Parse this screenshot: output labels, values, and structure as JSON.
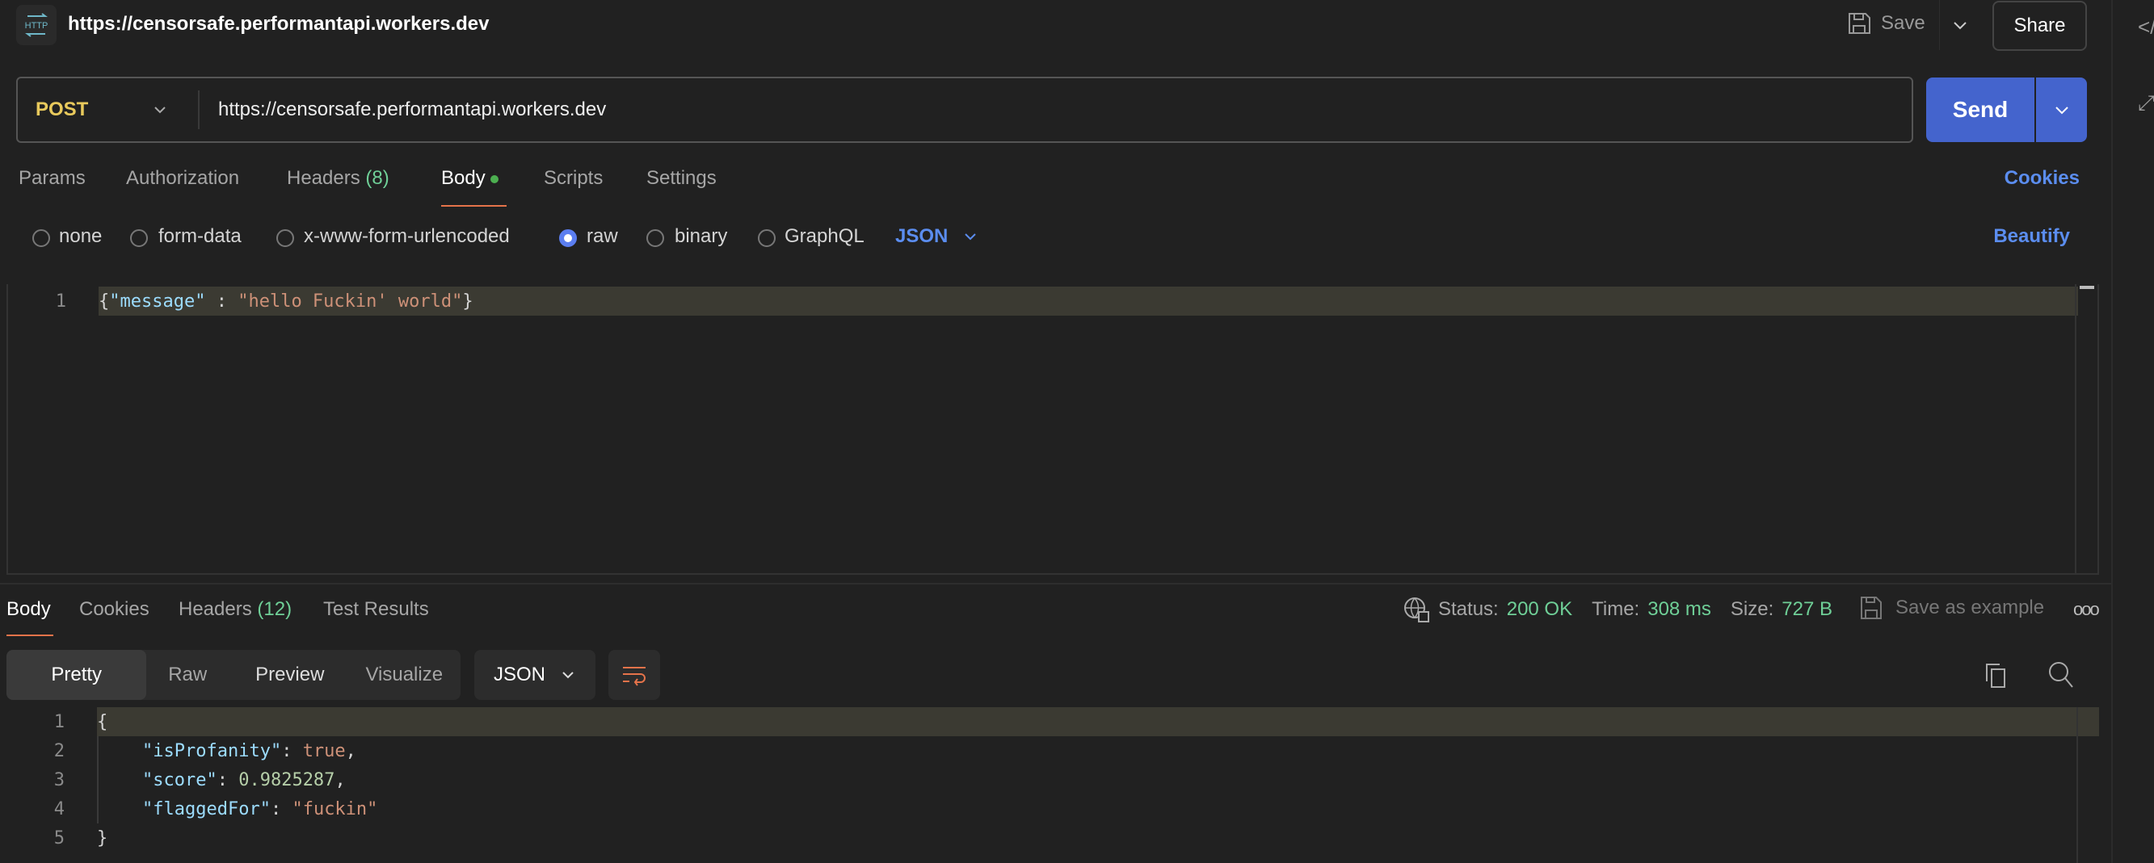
{
  "header": {
    "title": "https://censorsafe.performantapi.workers.dev",
    "icon": "http-icon",
    "save_label": "Save",
    "share_label": "Share"
  },
  "request": {
    "method": "POST",
    "url": "https://censorsafe.performantapi.workers.dev",
    "send_label": "Send",
    "method_color": "#e8c95c",
    "send_color": "#4464cd"
  },
  "tabs": [
    {
      "label": "Params"
    },
    {
      "label": "Authorization"
    },
    {
      "label": "Headers",
      "count": "(8)"
    },
    {
      "label": "Body"
    },
    {
      "label": "Scripts"
    },
    {
      "label": "Settings"
    }
  ],
  "active_tab": "Body",
  "cookies_label": "Cookies",
  "body_types": [
    "none",
    "form-data",
    "x-www-form-urlencoded",
    "raw",
    "binary",
    "GraphQL"
  ],
  "selected_body_type": "raw",
  "format": "JSON",
  "beautify_label": "Beautify",
  "request_body": {
    "line_numbers": [
      "1"
    ],
    "code": {
      "open": "{",
      "key": "\"message\"",
      "sep": " : ",
      "value": "\"hello Fuckin' world\"",
      "close": "}"
    }
  },
  "response": {
    "tabs": [
      {
        "label": "Body"
      },
      {
        "label": "Cookies"
      },
      {
        "label": "Headers",
        "count": "(12)"
      },
      {
        "label": "Test Results"
      }
    ],
    "status_label": "Status:",
    "status": "200 OK",
    "time_label": "Time:",
    "time": "308 ms",
    "size_label": "Size:",
    "size": "727 B",
    "save_example_label": "Save as example",
    "views": [
      "Pretty",
      "Raw",
      "Preview",
      "Visualize"
    ],
    "active_view": "Pretty",
    "format": "JSON",
    "line_numbers": [
      "1",
      "2",
      "3",
      "4",
      "5"
    ],
    "body": {
      "open": "{",
      "k1": "\"isProfanity\"",
      "v1": "true",
      "k2": "\"score\"",
      "v2": "0.9825287",
      "k3": "\"flaggedFor\"",
      "v3": "\"fuckin\"",
      "close": "}"
    }
  }
}
